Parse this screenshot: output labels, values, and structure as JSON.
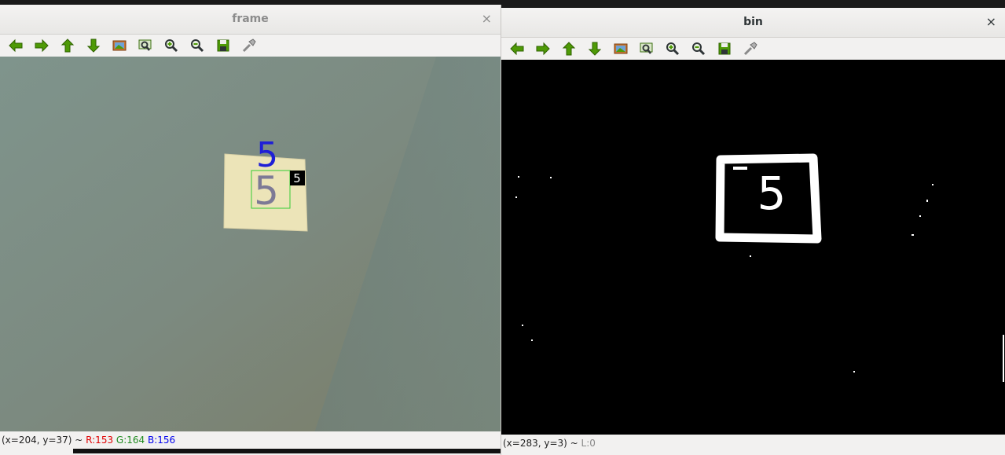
{
  "windows": {
    "frame": {
      "title": "frame",
      "close_glyph": "×",
      "status": {
        "coords": "(x=204, y=37) ~ ",
        "r": "R:153",
        "g": "G:164",
        "b": "B:156"
      },
      "overlay": {
        "predicted_digit": "5",
        "box_label": "5"
      }
    },
    "bin": {
      "title": "bin",
      "close_glyph": "×",
      "status": {
        "coords": "(x=283, y=3) ~ ",
        "l": "L:0"
      },
      "digit": "5"
    }
  },
  "toolbar_icons": [
    "arrow-left-icon",
    "arrow-right-icon",
    "arrow-up-icon",
    "arrow-down-icon",
    "zoom-original-icon",
    "zoom-fit-icon",
    "zoom-in-icon",
    "zoom-out-icon",
    "save-icon",
    "properties-icon"
  ],
  "colors": {
    "toolbar_green": "#4e9a06",
    "prediction_blue": "#1f1fd6",
    "roi_green": "#33cc33"
  }
}
